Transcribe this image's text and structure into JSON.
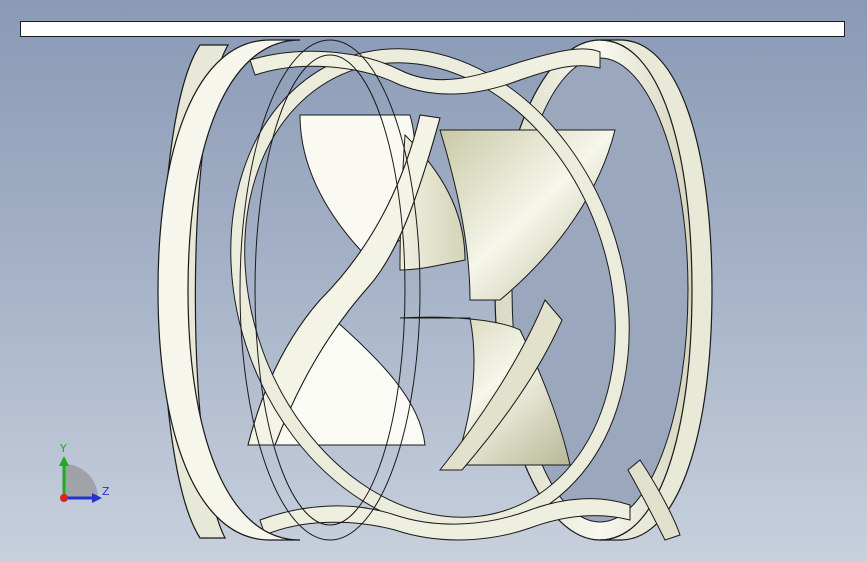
{
  "viewport": {
    "title_bar_text": "",
    "background_top": "#8a9ab5",
    "background_bottom": "#c8d0dd"
  },
  "model": {
    "name": "",
    "surface_color": "#f4f4ea",
    "shade_color": "#c8c8a8",
    "edge_color": "#1a1a1a"
  },
  "triad": {
    "y_label": "Y",
    "z_label": "Z",
    "y_color": "#22aa22",
    "z_color": "#2233cc",
    "origin_color": "#dd2222"
  }
}
